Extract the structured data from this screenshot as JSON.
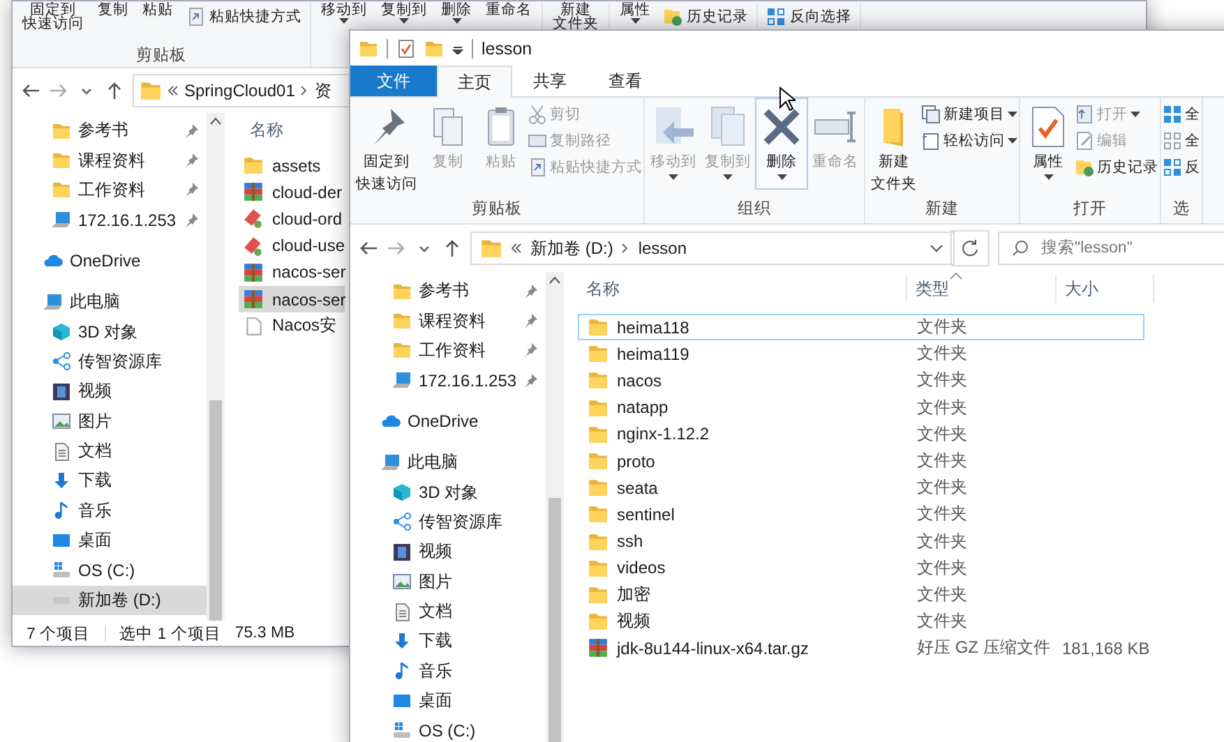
{
  "back_window": {
    "ribbon": [
      {
        "label": "剪贴板",
        "items": [
          {
            "lines": [
              "固定到",
              "快速访问"
            ],
            "kind": "large",
            "dropdown": false
          },
          {
            "label": "复制",
            "kind": "large",
            "dropdown": false
          },
          {
            "label": "粘贴",
            "kind": "large",
            "dropdown": false
          },
          {
            "label": "粘贴快捷方式",
            "kind": "small",
            "dropdown": false
          }
        ]
      },
      {
        "items": [
          {
            "label": "移动到",
            "kind": "large",
            "dropdown": true
          },
          {
            "label": "复制到",
            "kind": "large",
            "dropdown": true
          },
          {
            "label": "删除",
            "kind": "large",
            "dropdown": true
          },
          {
            "label": "重命名",
            "kind": "large",
            "dropdown": false
          }
        ]
      },
      {
        "items": [
          {
            "lines": [
              "新建",
              "文件夹"
            ],
            "kind": "large",
            "dropdown": false
          }
        ]
      },
      {
        "items": [
          {
            "label": "属性",
            "kind": "large",
            "dropdown": true
          },
          {
            "label": "历史记录",
            "kind": "small",
            "dropdown": false
          }
        ]
      },
      {
        "items": [
          {
            "label": "反向选择",
            "kind": "small",
            "dropdown": false
          }
        ]
      }
    ],
    "address": [
      "SpringCloud01",
      "资"
    ],
    "quick_access": [
      {
        "label": "参考书",
        "kind": "folder",
        "pinned": true,
        "selected": false
      },
      {
        "label": "课程资料",
        "kind": "folder",
        "pinned": true,
        "selected": false
      },
      {
        "label": "工作资料",
        "kind": "folder",
        "pinned": true,
        "selected": false
      },
      {
        "label": "172.16.1.253",
        "kind": "network",
        "pinned": true,
        "selected": false
      }
    ],
    "tree": [
      {
        "label": "OneDrive",
        "kind": "cloud",
        "selected": false
      },
      {
        "label": "此电脑",
        "kind": "computer",
        "selected": false,
        "children": [
          {
            "label": "3D 对象",
            "kind": "objects",
            "selected": false
          },
          {
            "label": "传智资源库",
            "kind": "library",
            "selected": false
          },
          {
            "label": "视频",
            "kind": "video",
            "selected": false
          },
          {
            "label": "图片",
            "kind": "picture",
            "selected": false
          },
          {
            "label": "文档",
            "kind": "document",
            "selected": false
          },
          {
            "label": "下载",
            "kind": "download",
            "selected": false
          },
          {
            "label": "音乐",
            "kind": "music",
            "selected": false
          },
          {
            "label": "桌面",
            "kind": "desktop",
            "selected": false
          },
          {
            "label": "OS (C:)",
            "kind": "sysdrive",
            "selected": false
          },
          {
            "label": "新加卷 (D:)",
            "kind": "drive",
            "selected": true
          }
        ]
      }
    ],
    "columns": [
      "名称"
    ],
    "files": [
      {
        "name": "assets",
        "kind": "folder",
        "selected": false
      },
      {
        "name": "cloud-der",
        "kind": "archive",
        "selected": false
      },
      {
        "name": "cloud-ord",
        "kind": "jar",
        "selected": false
      },
      {
        "name": "cloud-use",
        "kind": "jar",
        "selected": false
      },
      {
        "name": "nacos-ser",
        "kind": "archive",
        "selected": false
      },
      {
        "name": "nacos-ser",
        "kind": "archive",
        "selected": true
      },
      {
        "name": "Nacos安",
        "kind": "text",
        "selected": false
      }
    ],
    "status": [
      "7 个项目",
      "选中 1 个项目",
      "75.3 MB"
    ]
  },
  "front_window": {
    "title": "lesson",
    "tabs": [
      {
        "label": "文件",
        "kind": "menu",
        "selected": false
      },
      {
        "label": "主页",
        "kind": "tab",
        "selected": true
      },
      {
        "label": "共享",
        "kind": "tab",
        "selected": false
      },
      {
        "label": "查看",
        "kind": "tab",
        "selected": false
      }
    ],
    "ribbon": [
      {
        "label": "剪贴板",
        "items": [
          {
            "lines": [
              "固定到",
              "快速访问"
            ],
            "kind": "large",
            "disabled": false,
            "dropdown": false
          },
          {
            "label": "复制",
            "kind": "large",
            "disabled": true,
            "dropdown": false
          },
          {
            "label": "粘贴",
            "kind": "large",
            "disabled": true,
            "dropdown": false
          },
          {
            "label": "剪切",
            "kind": "small",
            "disabled": true,
            "dropdown": false
          },
          {
            "label": "复制路径",
            "kind": "small",
            "disabled": true,
            "dropdown": false
          },
          {
            "label": "粘贴快捷方式",
            "kind": "small",
            "disabled": true,
            "dropdown": false
          }
        ]
      },
      {
        "label": "组织",
        "items": [
          {
            "label": "移动到",
            "kind": "large",
            "disabled": true,
            "dropdown": true
          },
          {
            "label": "复制到",
            "kind": "large",
            "disabled": true,
            "dropdown": true
          },
          {
            "label": "删除",
            "kind": "large",
            "disabled": false,
            "dropdown": true,
            "hovered": true
          },
          {
            "label": "重命名",
            "kind": "large",
            "disabled": true,
            "dropdown": false
          }
        ]
      },
      {
        "label": "新建",
        "items": [
          {
            "lines": [
              "新建",
              "文件夹"
            ],
            "kind": "large",
            "disabled": false,
            "dropdown": false
          },
          {
            "label": "新建项目",
            "kind": "small",
            "disabled": false,
            "dropdown": true
          },
          {
            "label": "轻松访问",
            "kind": "small",
            "disabled": false,
            "dropdown": true
          }
        ]
      },
      {
        "label": "打开",
        "items": [
          {
            "label": "属性",
            "kind": "large",
            "disabled": false,
            "dropdown": true
          },
          {
            "label": "打开",
            "kind": "small",
            "disabled": true,
            "dropdown": true
          },
          {
            "label": "编辑",
            "kind": "small",
            "disabled": true,
            "dropdown": false
          },
          {
            "label": "历史记录",
            "kind": "small",
            "disabled": false,
            "dropdown": false
          }
        ]
      },
      {
        "label": "选",
        "items": [
          {
            "label": "全",
            "kind": "small",
            "disabled": false,
            "dropdown": false
          },
          {
            "label": "全",
            "kind": "small",
            "disabled": false,
            "dropdown": false
          },
          {
            "label": "反",
            "kind": "small",
            "disabled": false,
            "dropdown": false
          }
        ]
      }
    ],
    "address": [
      "新加卷 (D:)",
      "lesson"
    ],
    "search": {
      "placeholder": "搜索\"lesson\""
    },
    "quick_access": [
      {
        "label": "参考书",
        "kind": "folder",
        "pinned": true,
        "selected": false
      },
      {
        "label": "课程资料",
        "kind": "folder",
        "pinned": true,
        "selected": false
      },
      {
        "label": "工作资料",
        "kind": "folder",
        "pinned": true,
        "selected": false
      },
      {
        "label": "172.16.1.253",
        "kind": "network",
        "pinned": true,
        "selected": false
      }
    ],
    "tree": [
      {
        "label": "OneDrive",
        "kind": "cloud",
        "selected": false
      },
      {
        "label": "此电脑",
        "kind": "computer",
        "selected": false,
        "children": [
          {
            "label": "3D 对象",
            "kind": "objects",
            "selected": false
          },
          {
            "label": "传智资源库",
            "kind": "library",
            "selected": false
          },
          {
            "label": "视频",
            "kind": "video",
            "selected": false
          },
          {
            "label": "图片",
            "kind": "picture",
            "selected": false
          },
          {
            "label": "文档",
            "kind": "document",
            "selected": false
          },
          {
            "label": "下载",
            "kind": "download",
            "selected": false
          },
          {
            "label": "音乐",
            "kind": "music",
            "selected": false
          },
          {
            "label": "桌面",
            "kind": "desktop",
            "selected": false
          },
          {
            "label": "OS (C:)",
            "kind": "sysdrive",
            "selected": false
          }
        ]
      }
    ],
    "columns": [
      "名称",
      "类型",
      "大小"
    ],
    "files": [
      {
        "name": "heima118",
        "type": "文件夹",
        "kind": "folder",
        "focused": true
      },
      {
        "name": "heima119",
        "type": "文件夹",
        "kind": "folder",
        "focused": false
      },
      {
        "name": "nacos",
        "type": "文件夹",
        "kind": "folder",
        "focused": false
      },
      {
        "name": "natapp",
        "type": "文件夹",
        "kind": "folder",
        "focused": false
      },
      {
        "name": "nginx-1.12.2",
        "type": "文件夹",
        "kind": "folder",
        "focused": false
      },
      {
        "name": "proto",
        "type": "文件夹",
        "kind": "folder",
        "focused": false
      },
      {
        "name": "seata",
        "type": "文件夹",
        "kind": "folder",
        "focused": false
      },
      {
        "name": "sentinel",
        "type": "文件夹",
        "kind": "folder",
        "focused": false
      },
      {
        "name": "ssh",
        "type": "文件夹",
        "kind": "folder",
        "focused": false
      },
      {
        "name": "videos",
        "type": "文件夹",
        "kind": "folder",
        "focused": false
      },
      {
        "name": "加密",
        "type": "文件夹",
        "kind": "folder",
        "focused": false
      },
      {
        "name": "视频",
        "type": "文件夹",
        "kind": "folder",
        "focused": false
      },
      {
        "name": "jdk-8u144-linux-x64.tar.gz",
        "type": "好压 GZ 压缩文件",
        "size": "181,168 KB",
        "kind": "archive",
        "focused": false
      }
    ]
  }
}
